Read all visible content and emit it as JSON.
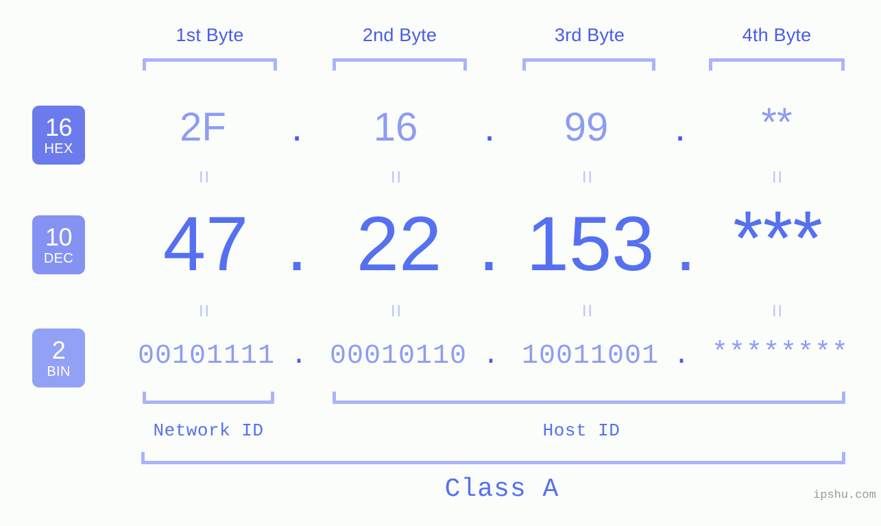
{
  "background": "#fbfdfa",
  "colors": {
    "header_text": "#4a5ce8",
    "bracket": "#aab4fa",
    "hex_value": "#8e9cf2",
    "dec_value": "#5570f0",
    "bin_value": "#8e9cf2",
    "badge_hex": "#6b7bec",
    "badge_dec": "#8592f2",
    "badge_bin": "#92a0f5",
    "equals_mark": "#c2cafb",
    "watermark": "#9a9a9a"
  },
  "byte_headers": [
    {
      "label": "1st Byte"
    },
    {
      "label": "2nd Byte"
    },
    {
      "label": "3rd Byte"
    },
    {
      "label": "4th Byte"
    }
  ],
  "rows": [
    {
      "badge": {
        "base": "16",
        "name": "HEX"
      },
      "values": [
        "2F",
        "16",
        "99",
        "**"
      ],
      "separator": "."
    },
    {
      "badge": {
        "base": "10",
        "name": "DEC"
      },
      "values": [
        "47",
        "22",
        "153",
        "***"
      ],
      "separator": "."
    },
    {
      "badge": {
        "base": "2",
        "name": "BIN"
      },
      "values": [
        "00101111",
        "00010110",
        "10011001",
        "********"
      ],
      "separator": "."
    }
  ],
  "equals_mark": "=",
  "segments": {
    "network_id": "Network ID",
    "host_id": "Host ID"
  },
  "class_label": "Class A",
  "watermark": "ipshu.com"
}
